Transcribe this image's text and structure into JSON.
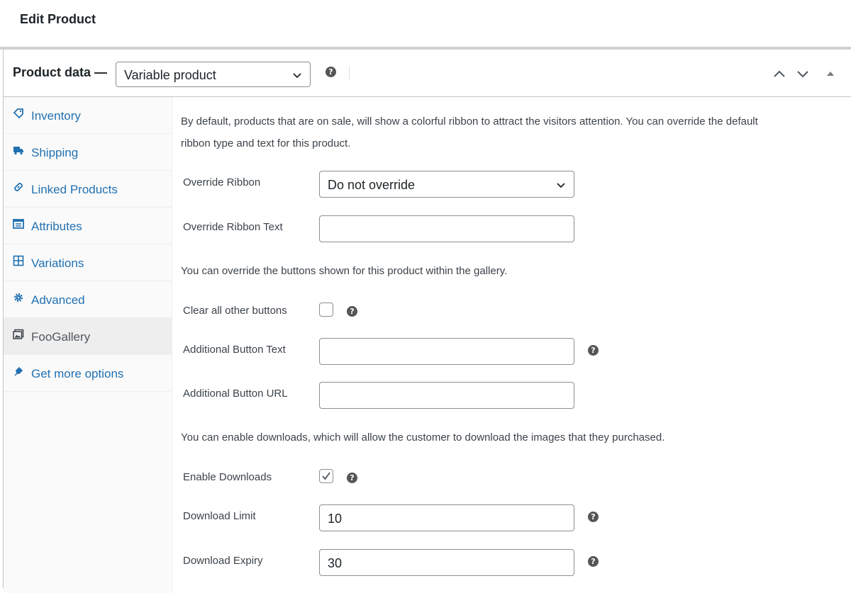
{
  "page": {
    "title": "Edit Product"
  },
  "metabox": {
    "title": "Product data —",
    "product_type": "Variable product",
    "controls": [
      "move-up",
      "move-down",
      "toggle-panel"
    ]
  },
  "tabs": [
    {
      "label": "Inventory",
      "icon": "tag-icon",
      "active": false
    },
    {
      "label": "Shipping",
      "icon": "truck-icon",
      "active": false
    },
    {
      "label": "Linked Products",
      "icon": "link-icon",
      "active": false
    },
    {
      "label": "Attributes",
      "icon": "list-icon",
      "active": false
    },
    {
      "label": "Variations",
      "icon": "grid-icon",
      "active": false
    },
    {
      "label": "Advanced",
      "icon": "gear-icon",
      "active": false
    },
    {
      "label": "FooGallery",
      "icon": "gallery-icon",
      "active": true
    },
    {
      "label": "Get more options",
      "icon": "plugin-icon",
      "active": false
    }
  ],
  "content": {
    "ribbon_intro_line1": "By default, products that are on sale, will show a colorful ribbon to attract the visitors attention. You can override the default",
    "ribbon_intro_line2": "ribbon type and text for this product.",
    "override_ribbon": {
      "label": "Override Ribbon",
      "value": "Do not override"
    },
    "override_ribbon_text": {
      "label": "Override Ribbon Text",
      "value": ""
    },
    "buttons_intro": "You can override the buttons shown for this product within the gallery.",
    "clear_buttons": {
      "label": "Clear all other buttons",
      "checked": false
    },
    "additional_button_text": {
      "label": "Additional Button Text",
      "value": ""
    },
    "additional_button_url": {
      "label": "Additional Button URL",
      "value": ""
    },
    "downloads_intro": "You can enable downloads, which will allow the customer to download the images that they purchased.",
    "enable_downloads": {
      "label": "Enable Downloads",
      "checked": true
    },
    "download_limit": {
      "label": "Download Limit",
      "value": "10"
    },
    "download_expiry": {
      "label": "Download Expiry",
      "value": "30"
    }
  },
  "colors": {
    "link": "#2271b1",
    "text": "#1d2327",
    "border": "#8c8f94",
    "active_tab_bg": "#eeeeee"
  }
}
